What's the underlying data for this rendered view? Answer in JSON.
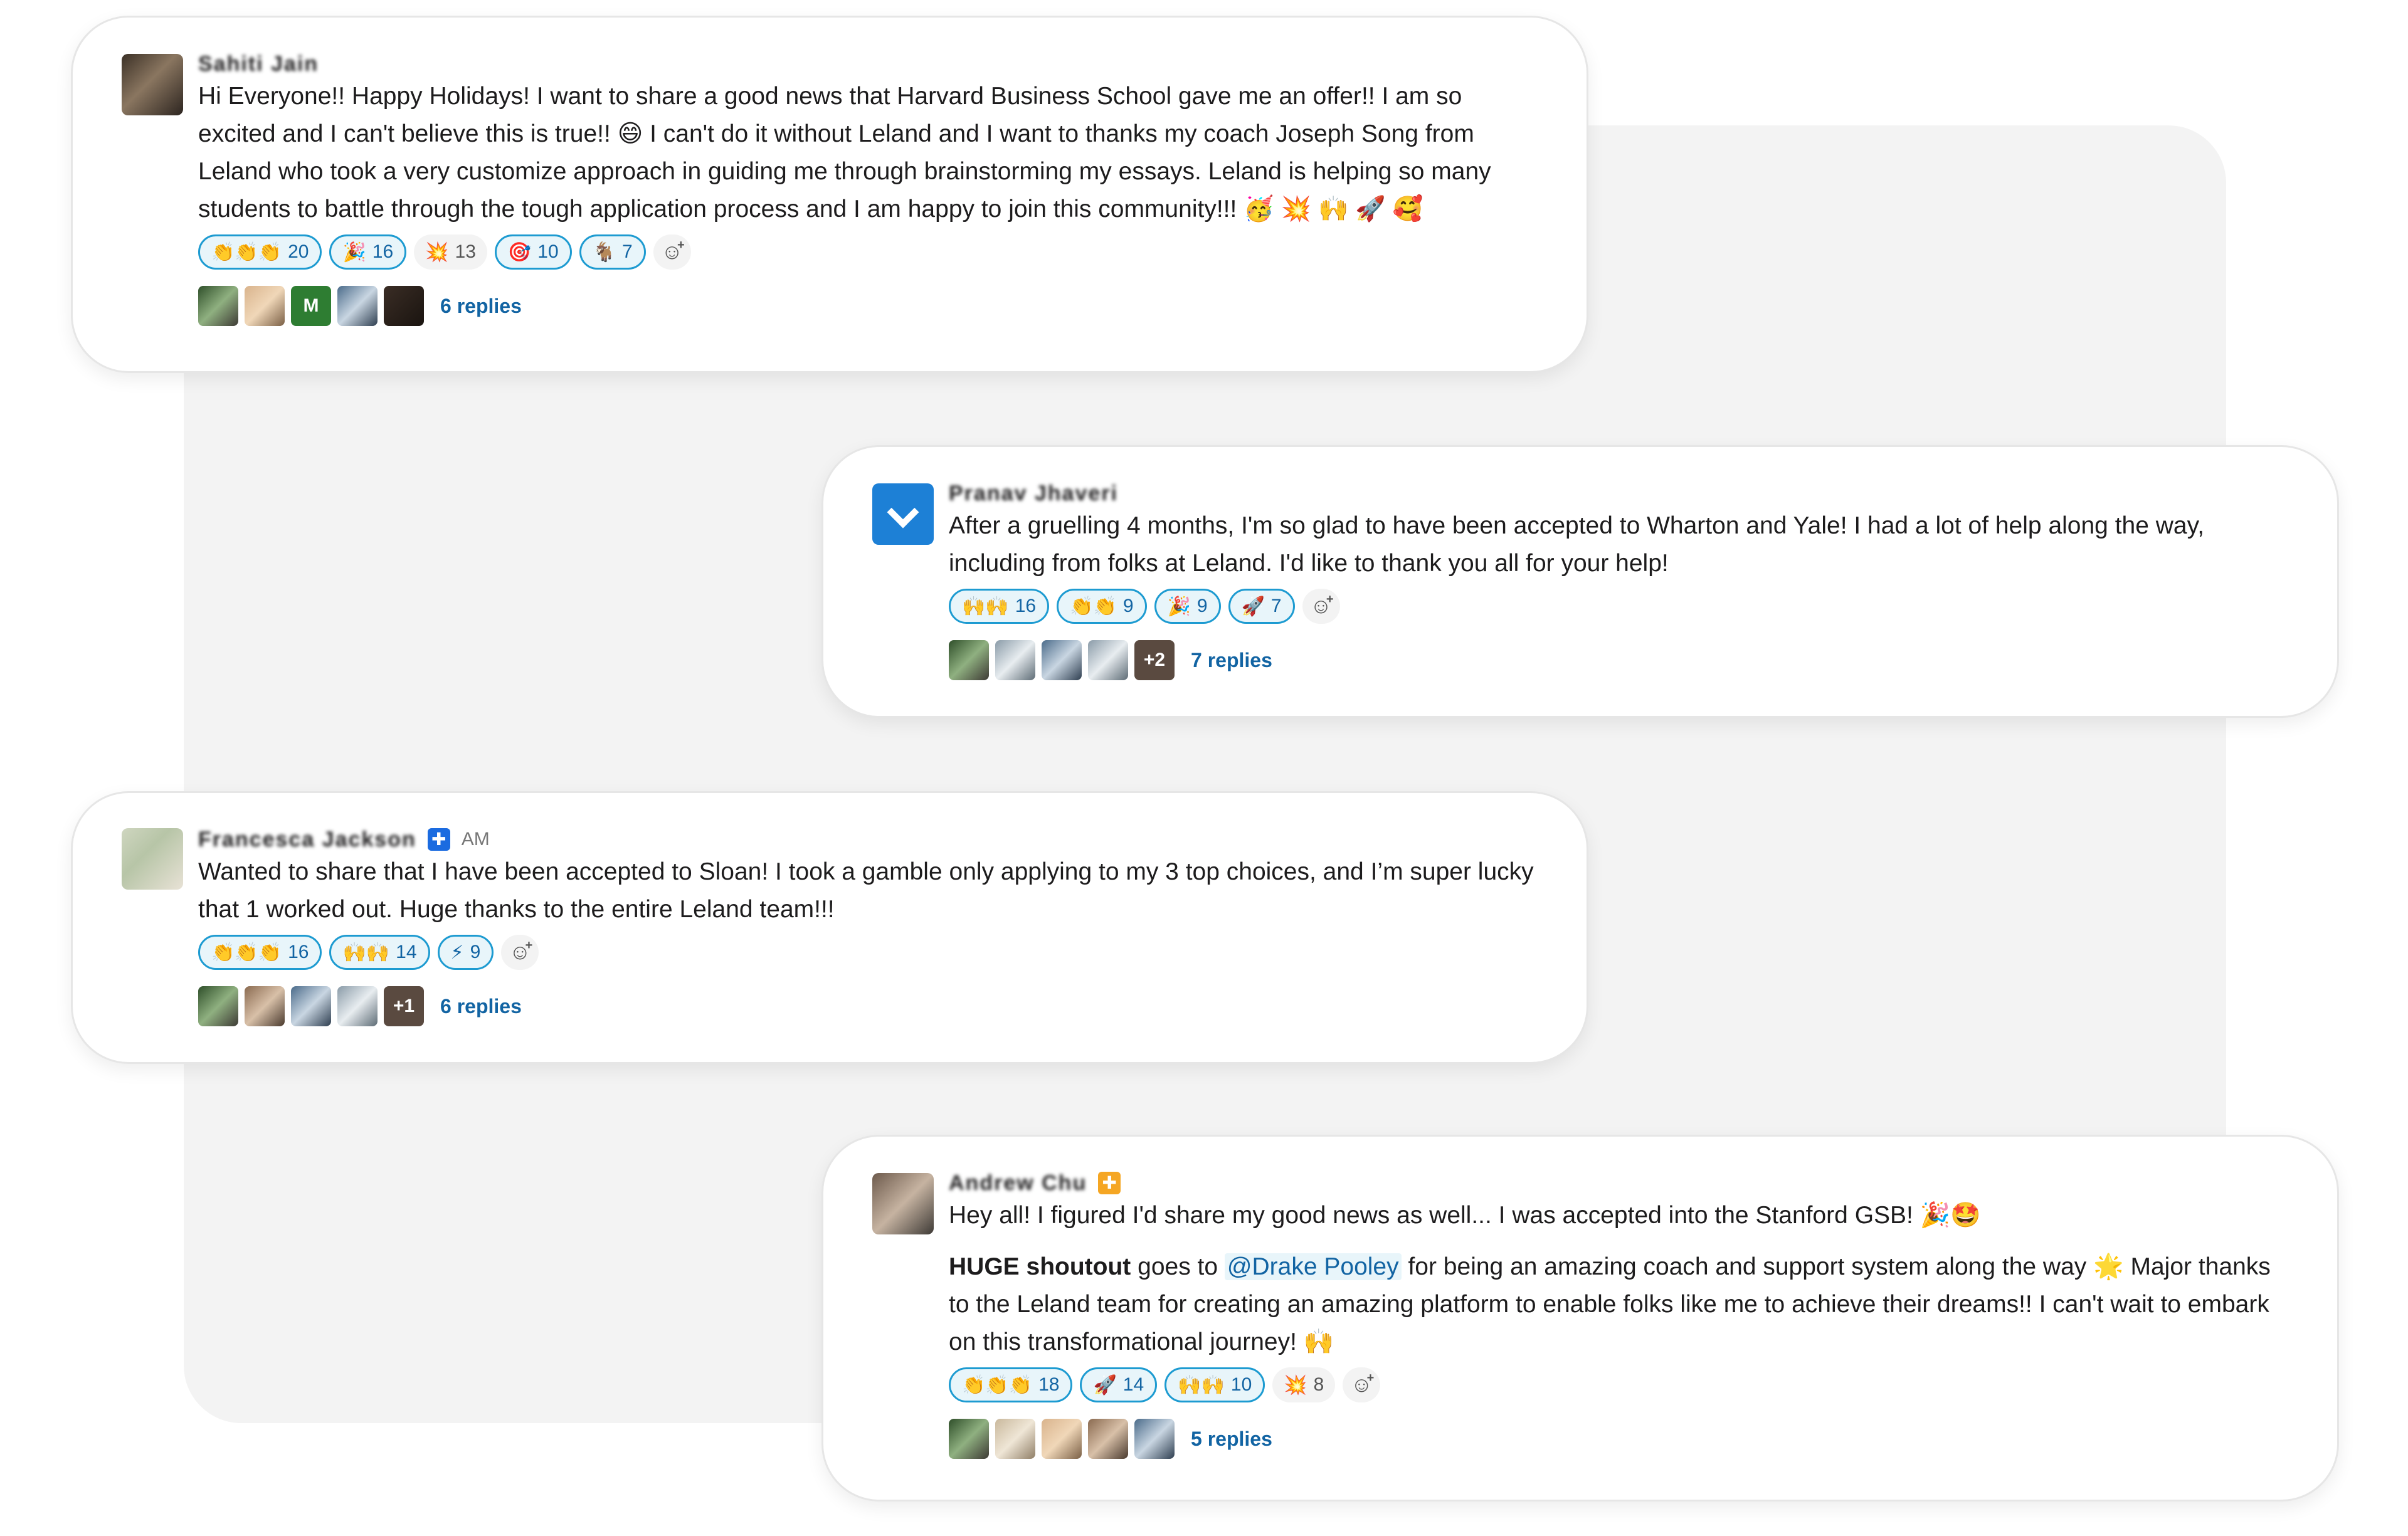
{
  "posts": [
    {
      "author": "Sahiti Jain",
      "time": "",
      "text": "Hi Everyone!! Happy Holidays! I want to share a good news that Harvard Business School gave me an offer!! I am so excited and I can't believe this is true!! 😄 I can't do it without Leland and I want to thanks my coach Joseph Song from Leland who took a very customize approach in guiding me through brainstorming my essays. Leland is helping so many students to battle through the tough application process and I am happy to join this community!!! 🥳 💥 🙌 🚀 🥰",
      "reactions": [
        {
          "emoji": "👏👏👏",
          "count": "20"
        },
        {
          "emoji": "🎉",
          "count": "16"
        },
        {
          "emoji": "💥",
          "count": "13"
        },
        {
          "emoji": "🎯",
          "count": "10"
        },
        {
          "emoji": "🐐",
          "count": "7"
        }
      ],
      "reply_avatar_label": "M",
      "replies": "6 replies"
    },
    {
      "author": "Pranav Jhaveri",
      "text": "After a gruelling 4 months, I'm so glad to have been accepted to Wharton and Yale! I had a lot of help along the way, including from folks at Leland. I'd like to thank you all for your help!",
      "reactions": [
        {
          "emoji": "🙌🙌",
          "count": "16"
        },
        {
          "emoji": "👏👏",
          "count": "9"
        },
        {
          "emoji": "🎉",
          "count": "9"
        },
        {
          "emoji": "🚀",
          "count": "7"
        }
      ],
      "extra_avatars": "+2",
      "replies": "7 replies"
    },
    {
      "author": "Francesca Jackson",
      "time": "AM",
      "text": "Wanted to share that I have been accepted to Sloan! I took a gamble only applying to my 3 top choices, and I’m super lucky that 1 worked out. Huge thanks to the entire Leland team!!!",
      "reactions": [
        {
          "emoji": "👏👏👏",
          "count": "16"
        },
        {
          "emoji": "🙌🙌",
          "count": "14"
        },
        {
          "emoji": "⚡",
          "count": "9"
        }
      ],
      "extra_avatars": "+1",
      "replies": "6 replies"
    },
    {
      "author": "Andrew Chu",
      "text_line1": "Hey all! I figured I'd share my good news as well... I was accepted into the Stanford GSB! 🎉🤩",
      "shoutout_bold": "HUGE shoutout",
      "shoutout_pre": " goes to ",
      "mention": "@Drake Pooley",
      "shoutout_post": " for being an amazing coach and support system along the way 🌟 Major thanks to the Leland team for creating an amazing platform to enable folks like me to achieve their dreams!! I can't wait to embark on this transformational journey! 🙌",
      "reactions": [
        {
          "emoji": "👏👏👏",
          "count": "18"
        },
        {
          "emoji": "🚀",
          "count": "14"
        },
        {
          "emoji": "🙌🙌",
          "count": "10"
        },
        {
          "emoji": "💥",
          "count": "8"
        }
      ],
      "replies": "5 replies"
    }
  ],
  "add_reaction_icon": "emoji-add-icon"
}
